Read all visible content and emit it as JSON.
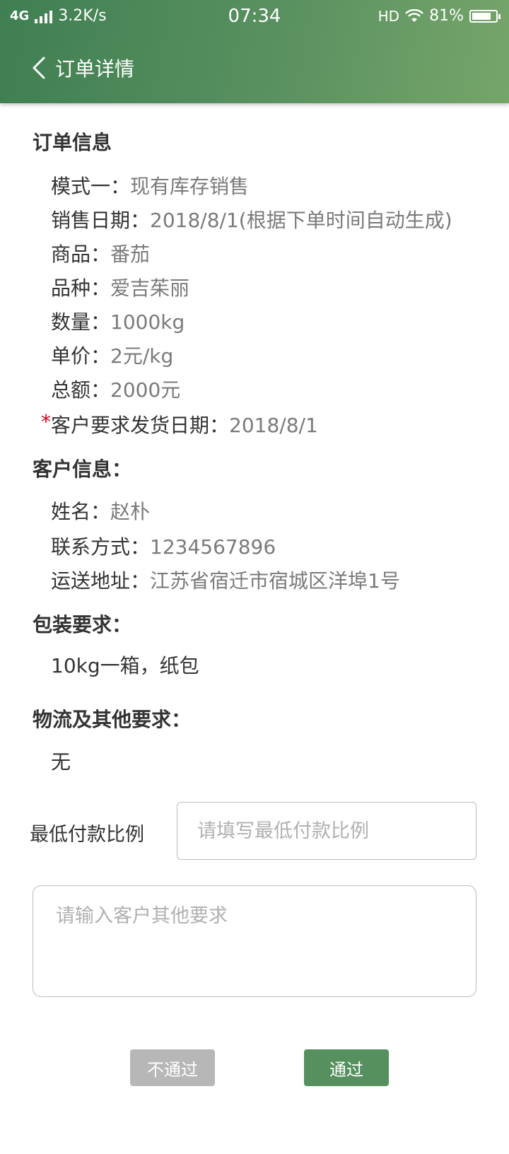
{
  "status_bar": {
    "network": "4G",
    "speed": "3.2K/s",
    "time": "07:34",
    "hd": "HD",
    "battery": "81%",
    "battery_level": 0.81
  },
  "nav": {
    "title": "订单详情",
    "back_icon": "chevron-left-icon"
  },
  "order_info": {
    "title": "订单信息",
    "mode": {
      "label": "模式一：",
      "value": "现有库存销售"
    },
    "sale_date": {
      "label": "销售日期：",
      "value": "2018/8/1(根据下单时间自动生成)"
    },
    "product": {
      "label": "商品：",
      "value": "番茄"
    },
    "variety": {
      "label": "品种：",
      "value": "爱吉茱丽"
    },
    "quantity": {
      "label": "数量：",
      "value": "1000kg"
    },
    "unit_price": {
      "label": "单价：",
      "value": "2元/kg"
    },
    "total": {
      "label": "总额：",
      "value": "2000元"
    },
    "ship_date": {
      "star": "*",
      "label": "客户要求发货日期：",
      "value": "2018/8/1"
    }
  },
  "customer_info": {
    "title": "客户信息：",
    "name": {
      "label": "姓名：",
      "value": "赵朴"
    },
    "contact": {
      "label": "联系方式：",
      "value": "1234567896"
    },
    "address": {
      "label": "运送地址：",
      "value": "江苏省宿迁市宿城区洋埠1号"
    }
  },
  "packaging": {
    "title": "包装要求：",
    "value": "10kg一箱，纸包"
  },
  "logistics": {
    "title": "物流及其他要求：",
    "value": "无"
  },
  "form": {
    "min_payment_label": "最低付款比例",
    "min_payment_placeholder": "请填写最低付款比例",
    "other_requirements_placeholder": "请输入客户其他要求"
  },
  "actions": {
    "reject_label": "不通过",
    "approve_label": "通过"
  },
  "colors": {
    "header": "#56905f",
    "approve": "#56905f",
    "reject": "#b7b7b7",
    "required": "#d0021b"
  }
}
